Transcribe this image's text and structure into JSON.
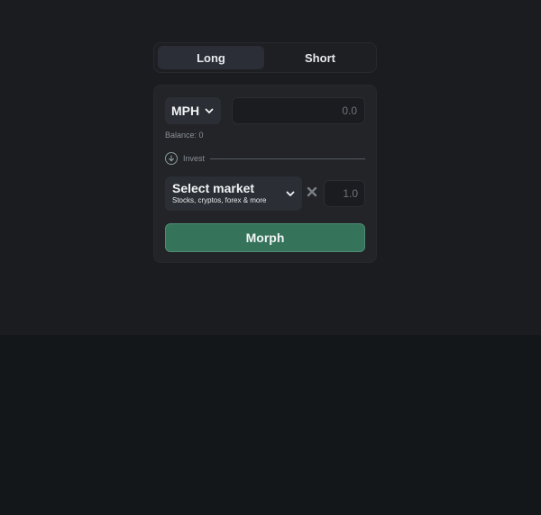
{
  "tabs": [
    {
      "label": "Long",
      "active": true
    },
    {
      "label": "Short",
      "active": false
    }
  ],
  "token": {
    "symbol": "MPH",
    "icon": "chevron-down-icon"
  },
  "amount": {
    "placeholder": "0.0"
  },
  "balance": {
    "text": "Balance: 0"
  },
  "invest": {
    "label": "Invest",
    "icon": "arrow-down-circle-icon"
  },
  "market": {
    "title": "Select market",
    "subtitle": "Stocks, cryptos, forex & more",
    "icon": "chevron-down-icon"
  },
  "multiplier": {
    "icon": "close-x-icon",
    "placeholder": "1.0"
  },
  "action": {
    "label": "Morph",
    "color": "#35735a"
  },
  "colors": {
    "background": "#141719",
    "panel": "#222428",
    "accent": "#35735a"
  }
}
